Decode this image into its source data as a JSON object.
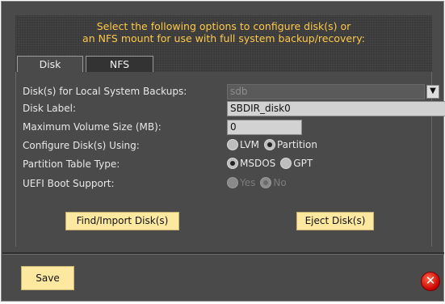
{
  "header": {
    "line1": "Select the following options to configure disk(s) or",
    "line2": "an NFS mount for use with full system backup/recovery:"
  },
  "tabs": [
    {
      "label": "Disk",
      "active": true
    },
    {
      "label": "NFS",
      "active": false
    }
  ],
  "form": {
    "disks_label": "Disk(s) for Local System Backups:",
    "disks_value": "sdb",
    "disk_label_label": "Disk Label:",
    "disk_label_value": "SBDIR_disk0",
    "max_volume_label": "Maximum Volume Size (MB):",
    "max_volume_value": "0",
    "configure_label": "Configure Disk(s) Using:",
    "configure_options": [
      "LVM",
      "Partition"
    ],
    "configure_selected": "Partition",
    "partition_table_label": "Partition Table Type:",
    "partition_table_options": [
      "MSDOS",
      "GPT"
    ],
    "partition_table_selected": "MSDOS",
    "uefi_label": "UEFI Boot Support:",
    "uefi_options": [
      "Yes",
      "No"
    ],
    "uefi_selected": "No"
  },
  "buttons": {
    "find_import": "Find/Import Disk(s)",
    "eject": "Eject Disk(s)",
    "save": "Save"
  },
  "icons": {
    "dropdown": "chevron-down-icon",
    "close": "close-icon"
  },
  "colors": {
    "header_text": "#ffc84a",
    "button_bg": "#fde8a0",
    "close": "#c80000"
  }
}
